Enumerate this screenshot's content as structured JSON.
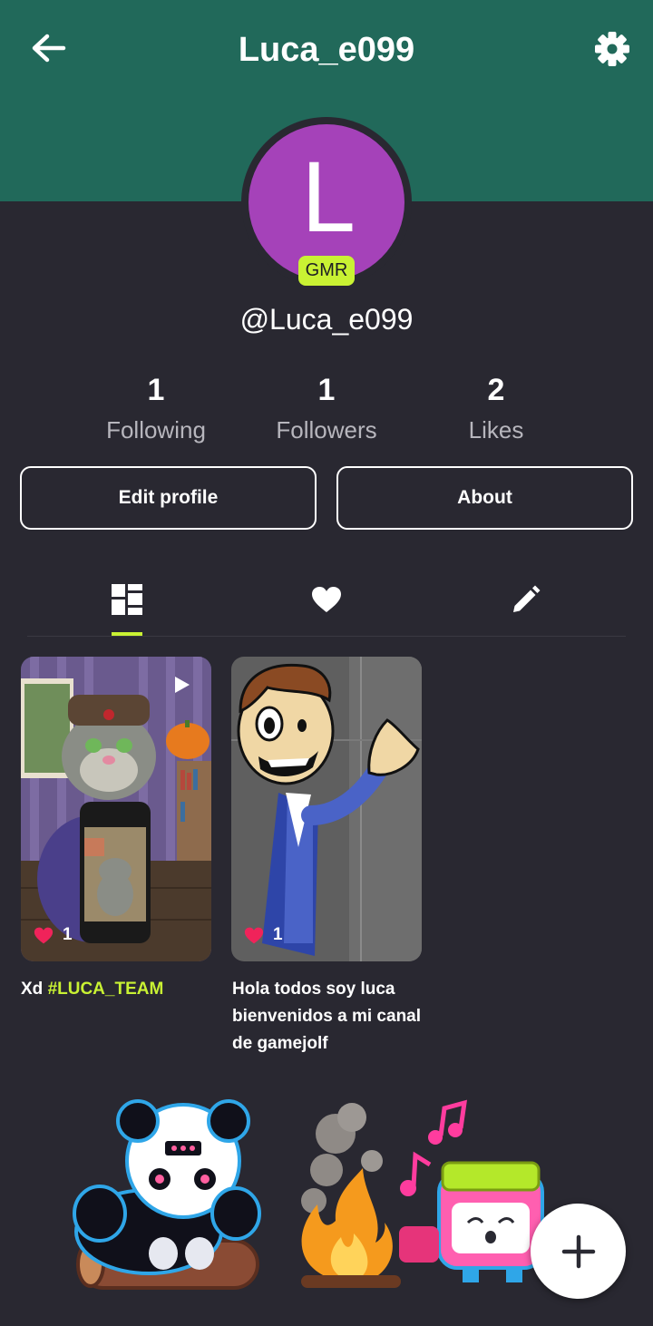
{
  "header": {
    "title": "Luca_e099",
    "back_icon": "arrow-left-icon",
    "settings_icon": "gear-icon",
    "background_color": "#21695a"
  },
  "profile": {
    "avatar_letter": "L",
    "avatar_color": "#a542b9",
    "badge": "GMR",
    "badge_color": "#c9f233",
    "handle": "@Luca_e099"
  },
  "stats": [
    {
      "value": "1",
      "label": "Following"
    },
    {
      "value": "1",
      "label": "Followers"
    },
    {
      "value": "2",
      "label": "Likes"
    }
  ],
  "buttons": {
    "edit_profile": "Edit profile",
    "about": "About"
  },
  "tabs": [
    {
      "icon": "grid-icon",
      "active": true
    },
    {
      "icon": "heart-icon",
      "active": false
    },
    {
      "icon": "pencil-icon",
      "active": false
    }
  ],
  "posts": [
    {
      "likes": "1",
      "caption_text": "Xd ",
      "caption_tag": "#LUCA_TEAM",
      "icon": "play-icon"
    },
    {
      "likes": "1",
      "caption_text": "Hola todos soy luca bienvenidos a mi canal de gamejolf"
    }
  ],
  "fab": {
    "icon": "plus-icon"
  },
  "accent_color": "#c9f233"
}
